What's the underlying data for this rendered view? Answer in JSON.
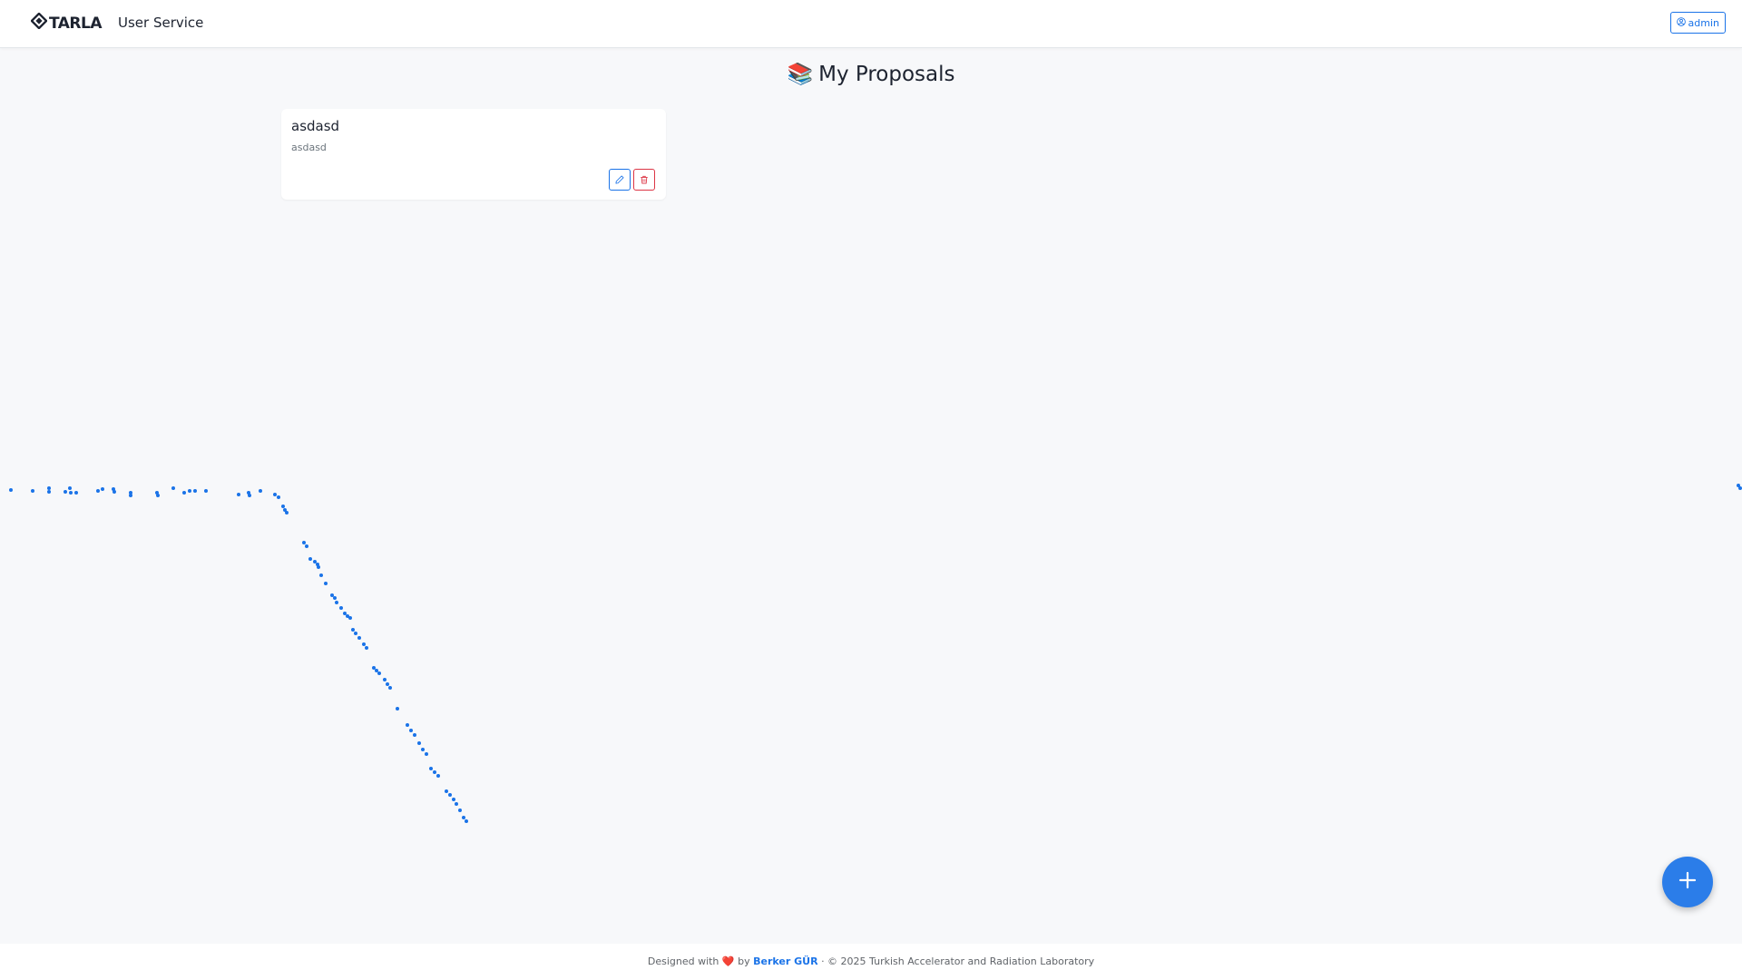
{
  "header": {
    "brand": "TARLA",
    "service_title": "User Service",
    "user_label": "admin"
  },
  "main": {
    "title_emoji": "📚",
    "title": "My Proposals",
    "cards": [
      {
        "title": "asdasd",
        "description": "asdasd"
      }
    ]
  },
  "footer": {
    "designed_with": "Designed with",
    "heart": "❤️",
    "by": "by",
    "author": "Berker GÜR",
    "copyright": "· © 2025 Turkish Accelerator and Radiation Laboratory"
  },
  "colors": {
    "accent": "#1a73e8",
    "danger": "#dc3545",
    "fab": "#2b7de9"
  },
  "icons": {
    "brand": "tarla-logo-icon",
    "user": "user-circle-icon",
    "edit": "pencil-icon",
    "delete": "trash-icon",
    "fab": "plus-icon"
  }
}
